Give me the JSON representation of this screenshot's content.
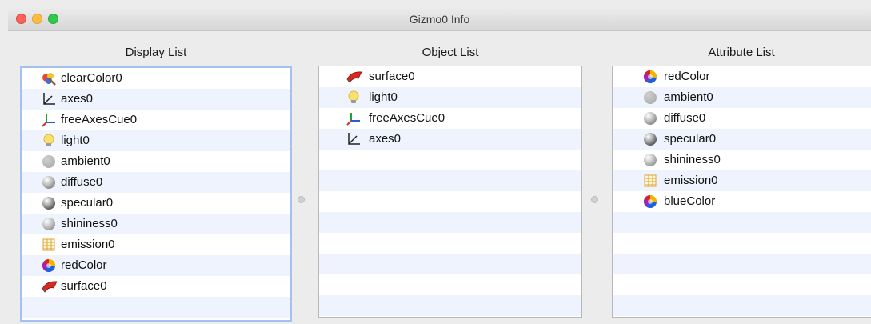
{
  "window": {
    "title": "Gizmo0 Info"
  },
  "display_list": {
    "header": "Display List",
    "items": [
      {
        "label": "clearColor0",
        "icon": "clear-color-icon"
      },
      {
        "label": "axes0",
        "icon": "axes-icon"
      },
      {
        "label": "freeAxesCue0",
        "icon": "free-axes-cue-icon"
      },
      {
        "label": "light0",
        "icon": "light-bulb-icon"
      },
      {
        "label": "ambient0",
        "icon": "ambient-sphere-icon"
      },
      {
        "label": "diffuse0",
        "icon": "diffuse-sphere-icon"
      },
      {
        "label": "specular0",
        "icon": "specular-sphere-icon"
      },
      {
        "label": "shininess0",
        "icon": "shininess-sphere-icon"
      },
      {
        "label": "emission0",
        "icon": "emission-icon"
      },
      {
        "label": "redColor",
        "icon": "color-wheel-icon"
      },
      {
        "label": "surface0",
        "icon": "surface-icon"
      }
    ]
  },
  "object_list": {
    "header": "Object List",
    "items": [
      {
        "label": "surface0",
        "icon": "surface-icon"
      },
      {
        "label": "light0",
        "icon": "light-bulb-icon"
      },
      {
        "label": "freeAxesCue0",
        "icon": "free-axes-cue-icon"
      },
      {
        "label": "axes0",
        "icon": "axes-icon"
      }
    ]
  },
  "attribute_list": {
    "header": "Attribute List",
    "items": [
      {
        "label": "redColor",
        "icon": "color-wheel-icon"
      },
      {
        "label": "ambient0",
        "icon": "ambient-sphere-icon"
      },
      {
        "label": "diffuse0",
        "icon": "diffuse-sphere-icon"
      },
      {
        "label": "specular0",
        "icon": "specular-sphere-icon"
      },
      {
        "label": "shininess0",
        "icon": "shininess-sphere-icon"
      },
      {
        "label": "emission0",
        "icon": "emission-icon"
      },
      {
        "label": "blueColor",
        "icon": "color-wheel-icon"
      }
    ]
  }
}
